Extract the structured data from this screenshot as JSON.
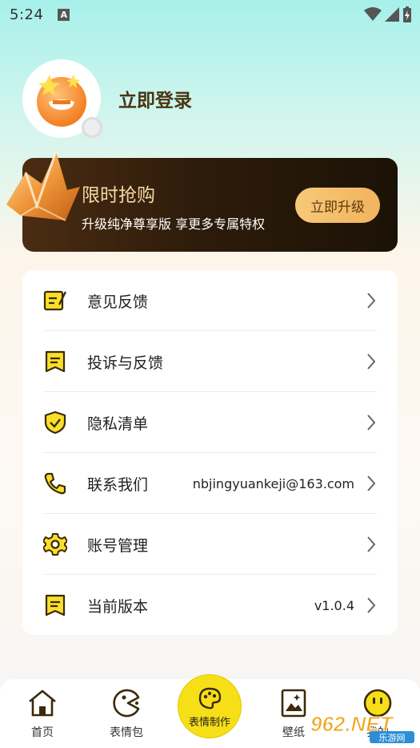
{
  "status_bar": {
    "time": "5:24",
    "notification_icon": "A"
  },
  "profile": {
    "login_label": "立即登录"
  },
  "vip": {
    "title": "限时抢购",
    "subtitle": "升级纯净尊享版 享更多专属特权",
    "button_label": "立即升级"
  },
  "menu": [
    {
      "label": "意见反馈",
      "value": "",
      "icon": "edit-note-icon"
    },
    {
      "label": "投诉与反馈",
      "value": "",
      "icon": "flag-note-icon"
    },
    {
      "label": "隐私清单",
      "value": "",
      "icon": "shield-check-icon"
    },
    {
      "label": "联系我们",
      "value": "nbjingyuankeji@163.com",
      "icon": "phone-icon"
    },
    {
      "label": "账号管理",
      "value": "",
      "icon": "gear-icon"
    },
    {
      "label": "当前版本",
      "value": "v1.0.4",
      "icon": "version-note-icon"
    }
  ],
  "tabbar": {
    "home": "首页",
    "emoji_pack": "表情包",
    "make": "表情制作",
    "wallpaper": "壁纸",
    "mine": "我的"
  },
  "watermark": {
    "text": "962.NET",
    "sub": "乐游网"
  },
  "colors": {
    "accent": "#f6df17",
    "brand_dark": "#2e1c0b",
    "gold": "#f7c978",
    "icon_brown": "#3c2a08"
  }
}
